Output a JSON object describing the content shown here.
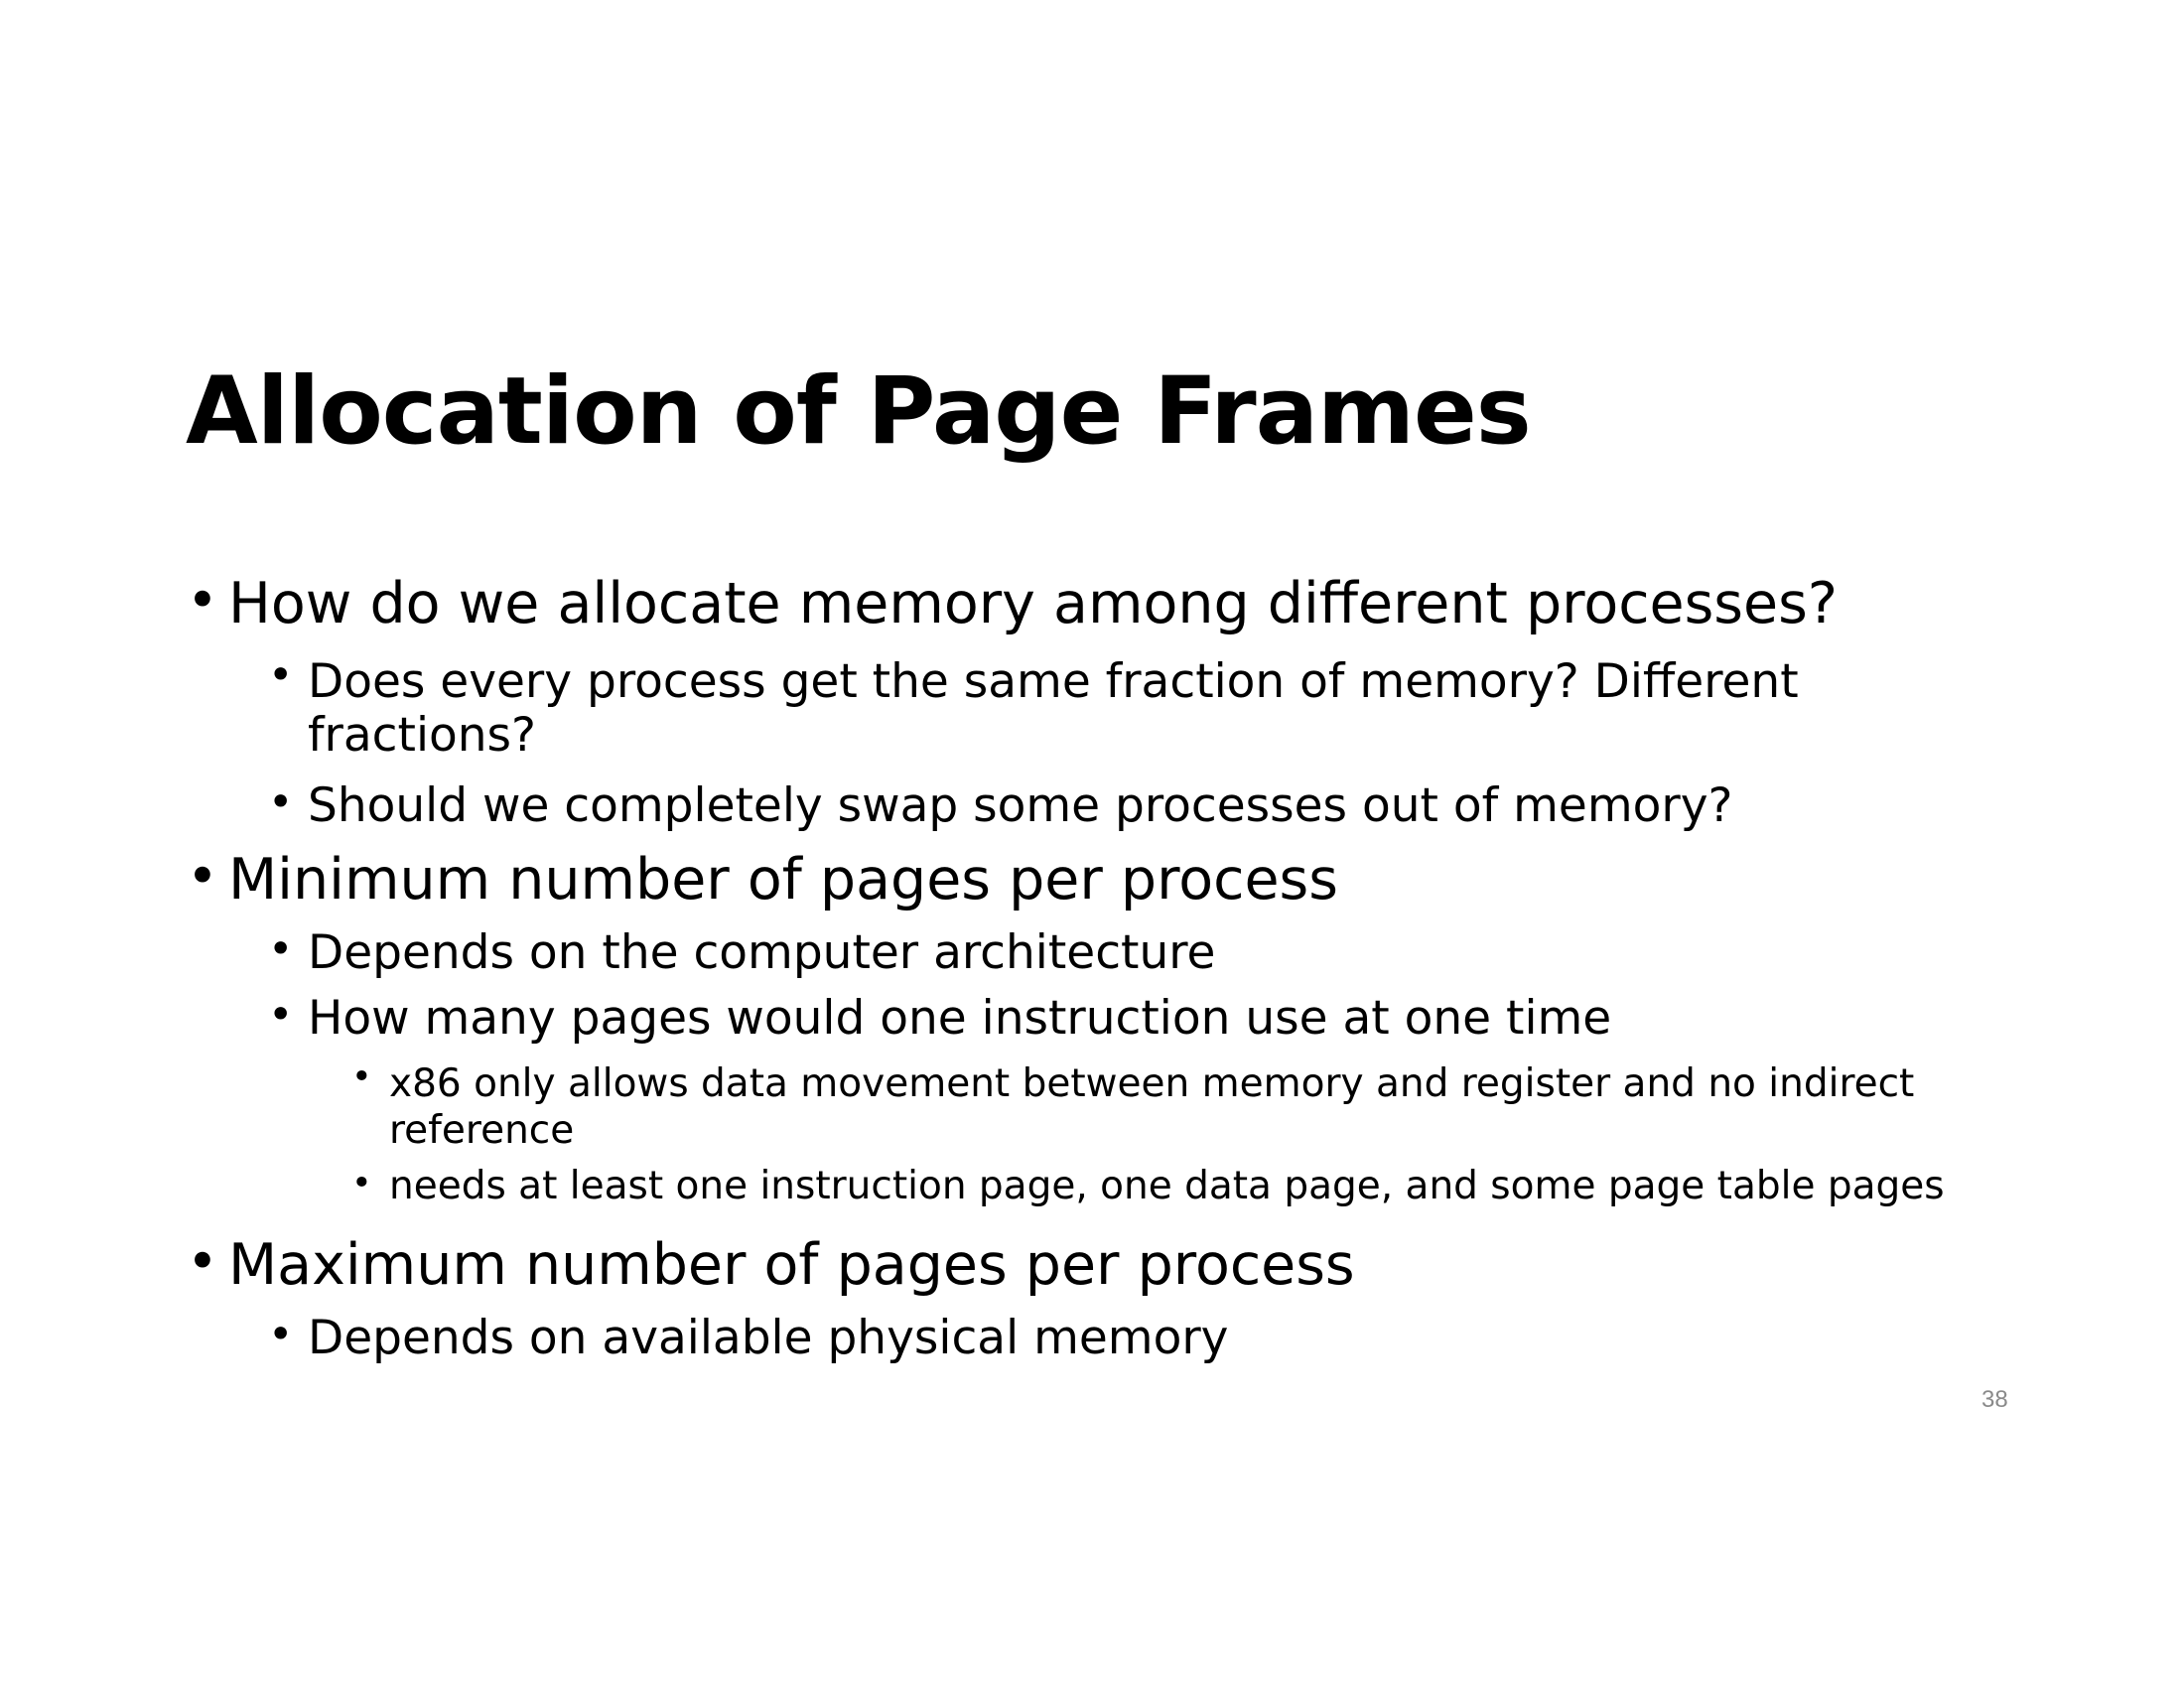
{
  "slide": {
    "title": "Allocation of Page Frames",
    "bullet_char": "•",
    "bullets": [
      {
        "text": "How do we allocate memory among different processes?",
        "children": [
          {
            "text": "Does every process get the same fraction of memory?  Different fractions?"
          },
          {
            "text": "Should we completely swap some processes out of memory?"
          }
        ]
      },
      {
        "text": "Minimum number of pages per process",
        "children": [
          {
            "text": "Depends on the computer architecture"
          },
          {
            "text": "How many pages would one instruction use at one time",
            "children": [
              {
                "text": "x86 only allows data movement between memory and register and no indirect reference"
              },
              {
                "text": "needs at least one instruction page, one data page, and some page table pages"
              }
            ]
          }
        ]
      },
      {
        "text": "Maximum number of pages per process",
        "children": [
          {
            "text": "Depends on available physical memory"
          }
        ]
      }
    ],
    "page_number": "38"
  }
}
